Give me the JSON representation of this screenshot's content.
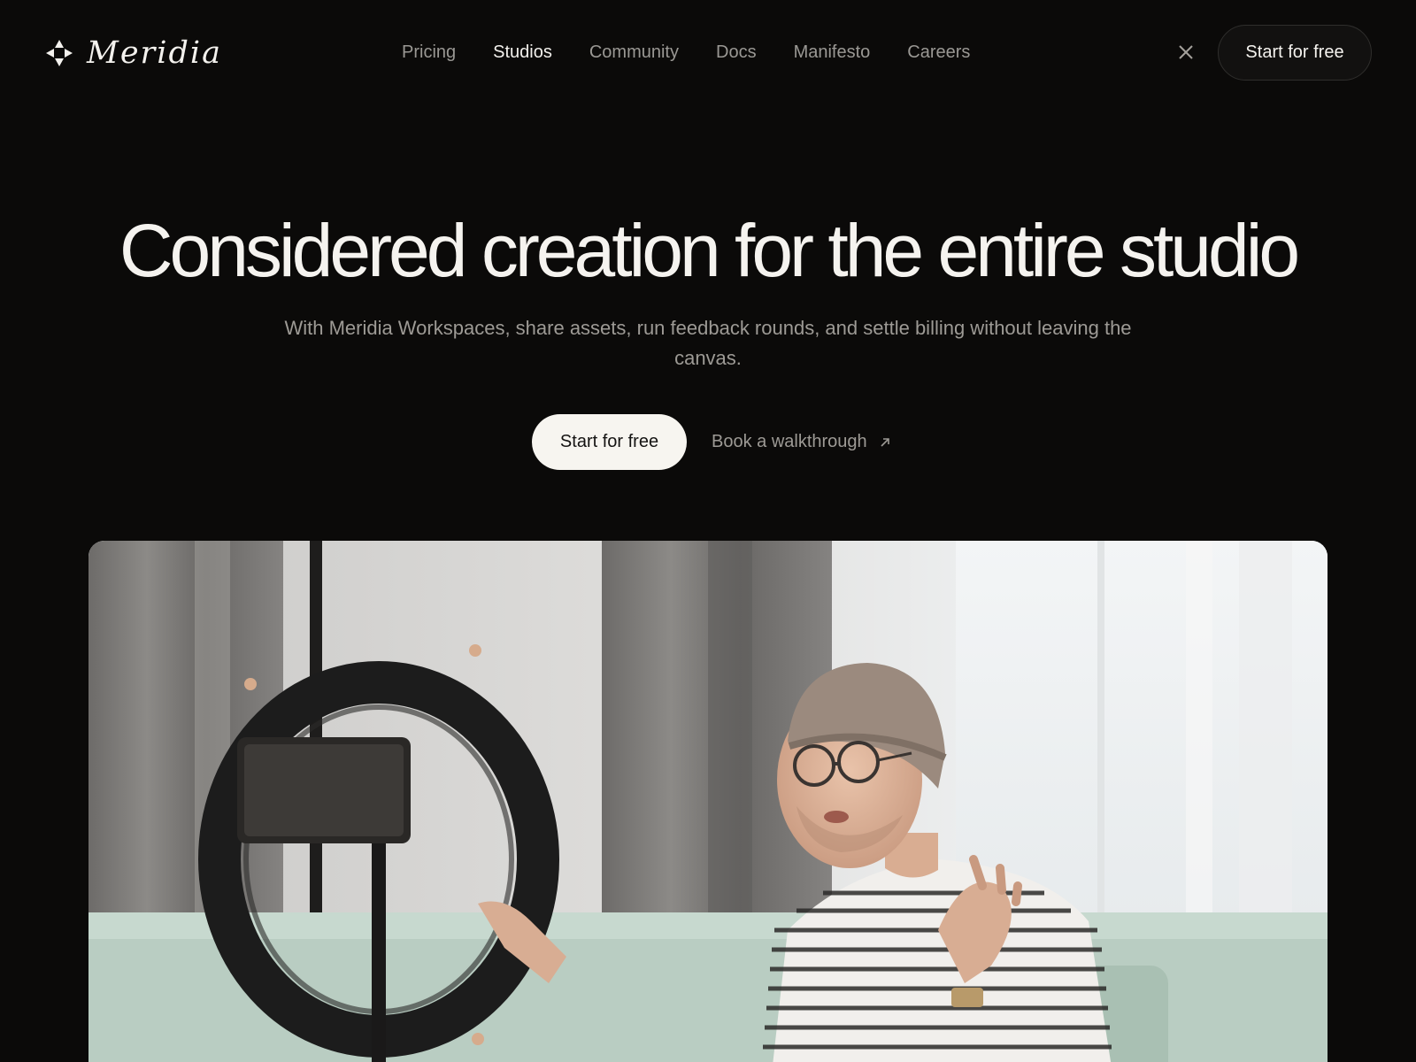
{
  "brand": {
    "name": "Meridia",
    "logo_icon": "four-pointed-compass-icon"
  },
  "nav": {
    "links": [
      {
        "label": "Pricing",
        "active": false
      },
      {
        "label": "Studios",
        "active": true
      },
      {
        "label": "Community",
        "active": false
      },
      {
        "label": "Docs",
        "active": false
      },
      {
        "label": "Manifesto",
        "active": false
      },
      {
        "label": "Careers",
        "active": false
      }
    ],
    "close_icon": "close-icon",
    "cta_label": "Start for free"
  },
  "hero": {
    "title": "Considered creation for the entire studio",
    "subtitle": "With Meridia Workspaces, share assets, run feedback rounds, and settle billing without leaving the canvas.",
    "primary_cta": "Start for free",
    "secondary_cta": "Book a walkthrough",
    "secondary_cta_icon": "arrow-up-right-icon"
  },
  "colors": {
    "background": "#0b0a09",
    "text_primary": "#f5f3ef",
    "text_muted": "#9d9a95",
    "button_light": "#f7f5f0"
  }
}
